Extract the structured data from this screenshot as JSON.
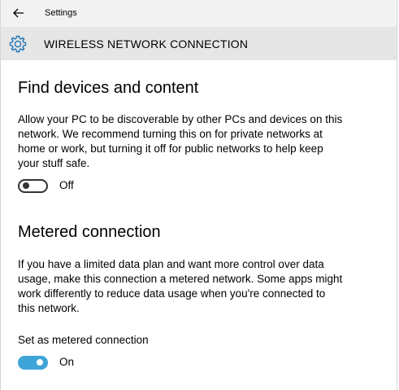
{
  "titlebar": {
    "app_title": "Settings",
    "back_icon": "arrow-left-icon"
  },
  "header": {
    "icon": "gear-icon",
    "title": "WIRELESS NETWORK CONNECTION",
    "accent_color": "#1e74b7"
  },
  "find_devices": {
    "heading": "Find devices and content",
    "description_lines": [
      "Allow your PC to be discoverable by other PCs and devices on this",
      "network. We recommend turning this on for private networks at",
      "home or work, but turning it off for public networks to help keep",
      "your stuff safe."
    ],
    "toggle": {
      "state": "off",
      "label": "Off"
    }
  },
  "metered": {
    "heading": "Metered connection",
    "description_lines": [
      "If you have a limited data plan and want more control over data",
      "usage, make this connection a metered network. Some apps might",
      "work differently to reduce data usage when you're connected to",
      "this network."
    ],
    "setting_label": "Set as metered connection",
    "toggle": {
      "state": "on",
      "label": "On",
      "color": "#3fa4d8"
    }
  }
}
